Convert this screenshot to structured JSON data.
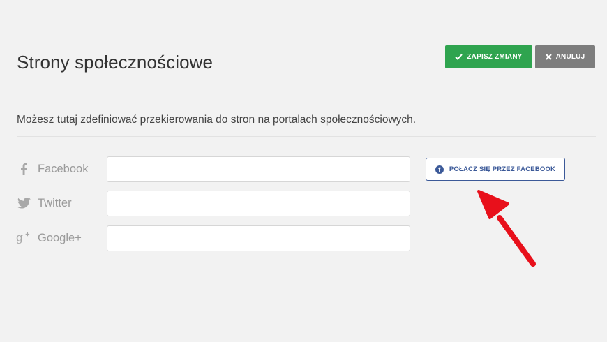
{
  "header": {
    "title": "Strony społecznościowe",
    "save_label": "ZAPISZ ZMIANY",
    "cancel_label": "ANULUJ"
  },
  "description": "Możesz tutaj zdefiniować przekierowania do stron na portalach społecznościowych.",
  "fields": [
    {
      "icon": "facebook-icon",
      "label": "Facebook",
      "value": "",
      "placeholder": ""
    },
    {
      "icon": "twitter-icon",
      "label": "Twitter",
      "value": "",
      "placeholder": ""
    },
    {
      "icon": "google-plus-icon",
      "label": "Google+",
      "value": "",
      "placeholder": ""
    }
  ],
  "facebook_connect": {
    "label": "POŁĄCZ SIĘ PRZEZ FACEBOOK",
    "icon_letter": "f"
  },
  "colors": {
    "save": "#2fa44f",
    "cancel": "#7d7d7d",
    "facebook": "#3b5998",
    "arrow": "#e8101b"
  }
}
